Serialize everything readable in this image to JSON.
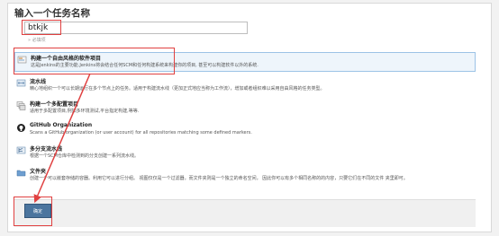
{
  "title": "输入一个任务名称",
  "name_input": {
    "value": "btkjk",
    "hint": "» 必填项"
  },
  "items": [
    {
      "label": "构建一个自由风格的软件项目",
      "desc": "这是Jenkins的主要功能.Jenkins将会结合任何SCM和任何构建系统来构建你的项目, 甚至可以构建软件以外的系统.",
      "icon": "freestyle-icon",
      "selected": true
    },
    {
      "label": "流水线",
      "desc": "精心地组织一个可以长期运行在多个节点上的任务。适用于构建流水线（更加正式地应当称为工作流），增加或者组织难以采用自由风格的任务类型。",
      "icon": "pipeline-icon"
    },
    {
      "label": "构建一个多配置项目",
      "desc": "适用于多配置项目,例如多环境测试,平台指定构建,等等.",
      "icon": "multi-config-icon"
    },
    {
      "label": "GitHub Organization",
      "desc": "Scans a GitHub organization (or user account) for all repositories matching some defined markers.",
      "icon": "github-org-icon"
    },
    {
      "label": "多分支流水线",
      "desc": "根据一个SCM仓库中检测到的分支创建一系列流水线。",
      "icon": "multibranch-icon"
    },
    {
      "label": "文件夹",
      "desc": "创建一个可以嵌套存储的容器。利用它可以进行分组。 视图仅仅是一个过滤器，而文件夹则是一个独立的命名空间， 因此你可以有多个相同名称的的内容，只要它们在不同的文件 夹里即可。",
      "icon": "folder-icon"
    }
  ],
  "ok_button": "确定",
  "colors": {
    "accent_red": "#e04040",
    "button_blue": "#4b759e",
    "selection_bg": "#eef5fb"
  }
}
